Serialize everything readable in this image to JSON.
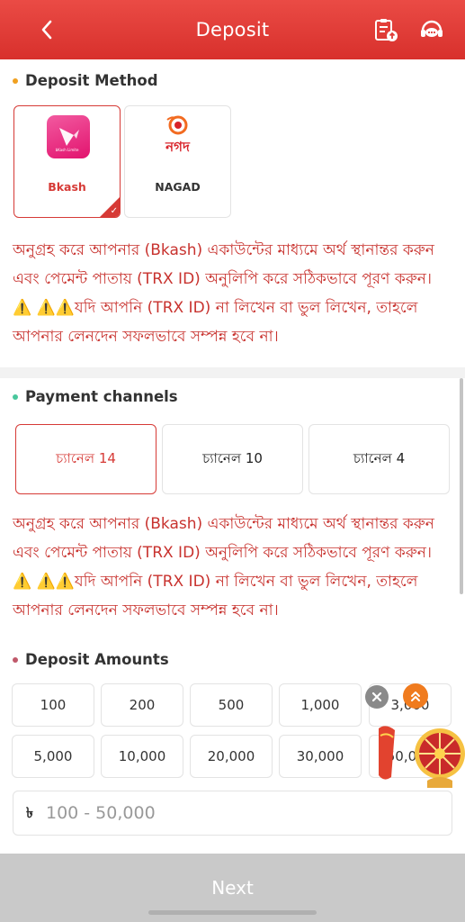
{
  "header": {
    "title": "Deposit"
  },
  "deposit_method": {
    "title": "Deposit Method",
    "methods": [
      {
        "label": "Bkash",
        "logo_text": "bKash Limite",
        "selected": true
      },
      {
        "label": "NAGAD",
        "logo_text": "নগদ",
        "selected": false
      }
    ]
  },
  "notice_text": "অনুগ্রহ করে আপনার (Bkash) একাউন্টের মাধ্যমে অর্থ স্থানান্তর করুন এবং পেমেন্ট পাতায় (TRX ID) অনুলিপি করে সঠিকভাবে পূরণ করুন। ⚠️ ⚠️⚠️যদি আপনি (TRX ID) না লিখেন বা ভুল লিখেন, তাহলে আপনার লেনদেন সফলভাবে সম্পন্ন হবে না।",
  "payment_channels": {
    "title": "Payment channels",
    "channels": [
      "চ্যানেল 14",
      "চ্যানেল 10",
      "চ্যানেল 4"
    ],
    "selected_index": 0
  },
  "deposit_amounts": {
    "title": "Deposit Amounts",
    "amounts": [
      "100",
      "200",
      "500",
      "1,000",
      "3,000",
      "5,000",
      "10,000",
      "20,000",
      "30,000",
      "50,000"
    ]
  },
  "amount_input": {
    "currency": "৳",
    "placeholder": "100 - 50,000"
  },
  "next_button": {
    "label": "Next"
  },
  "colors": {
    "header": "#e03b36",
    "accent": "#d63a36",
    "dot_method": "#f0a020",
    "dot_channels": "#49c79c",
    "dot_amounts": "#c0596a",
    "float_top": "#f07b1e"
  }
}
